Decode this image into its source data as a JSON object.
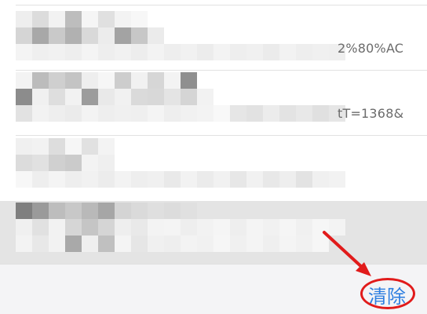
{
  "history_list": {
    "rows": [
      {
        "suffix": "",
        "highlighted": false
      },
      {
        "suffix": "2%80%AC",
        "highlighted": false
      },
      {
        "suffix": "tT=1368&",
        "highlighted": false
      },
      {
        "suffix": "",
        "highlighted": false
      },
      {
        "suffix": "",
        "highlighted": true
      }
    ]
  },
  "footer": {
    "clear_label": "清除"
  },
  "annotation": {
    "color": "#e11b1b"
  },
  "colors": {
    "link_blue": "#2f7fe0"
  }
}
